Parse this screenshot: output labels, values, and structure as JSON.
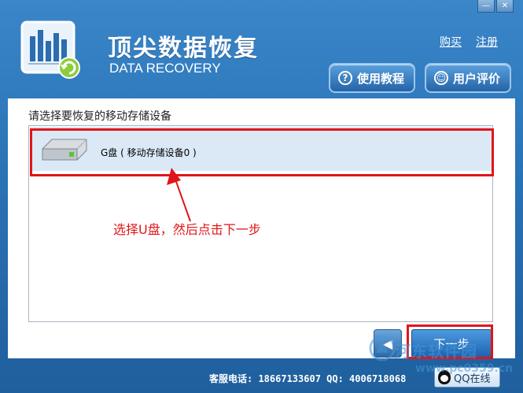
{
  "window": {
    "minimize_glyph": "—",
    "close_glyph": "✕"
  },
  "header": {
    "title_cn": "顶尖数据恢复",
    "title_en": "DATA RECOVERY",
    "link_buy": "购买",
    "link_register": "注册",
    "btn_tutorial": "使用教程",
    "btn_review": "用户评价",
    "icon_tutorial_glyph": "?",
    "icon_review_glyph": "☺"
  },
  "main": {
    "prompt": "请选择要恢复的移动存储设备",
    "devices": [
      {
        "label": "G盘 ( 移动存储设备0 )"
      }
    ],
    "annotation": "选择U盘，然后点击下一步"
  },
  "nav": {
    "next_label": "下一步",
    "back_glyph": "◀"
  },
  "footer": {
    "service_text": "客服电话: 18667133607  QQ: 4006718068",
    "qq_label": "QQ在线"
  },
  "watermark": {
    "line1": "河东软件园",
    "line2": "www.pc0359.cn"
  },
  "colors": {
    "accent": "#2b74b8",
    "highlight_red": "#e0151a"
  }
}
